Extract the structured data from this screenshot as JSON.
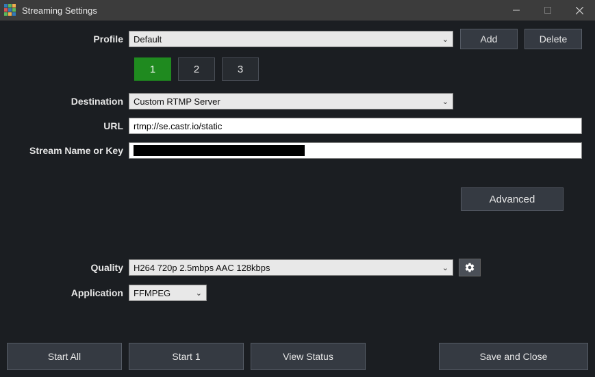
{
  "window": {
    "title": "Streaming Settings"
  },
  "profile": {
    "label": "Profile",
    "value": "Default",
    "add_label": "Add",
    "delete_label": "Delete"
  },
  "tabs": {
    "items": [
      "1",
      "2",
      "3"
    ],
    "active_index": 0
  },
  "destination": {
    "label": "Destination",
    "value": "Custom RTMP Server"
  },
  "url": {
    "label": "URL",
    "value": "rtmp://se.castr.io/static"
  },
  "stream_key": {
    "label": "Stream Name or Key",
    "value": ""
  },
  "advanced_label": "Advanced",
  "quality": {
    "label": "Quality",
    "value": "H264 720p 2.5mbps AAC 128kbps"
  },
  "application": {
    "label": "Application",
    "value": "FFMPEG"
  },
  "buttons": {
    "start_all": "Start All",
    "start_1": "Start 1",
    "view_status": "View Status",
    "save_close": "Save and Close"
  }
}
